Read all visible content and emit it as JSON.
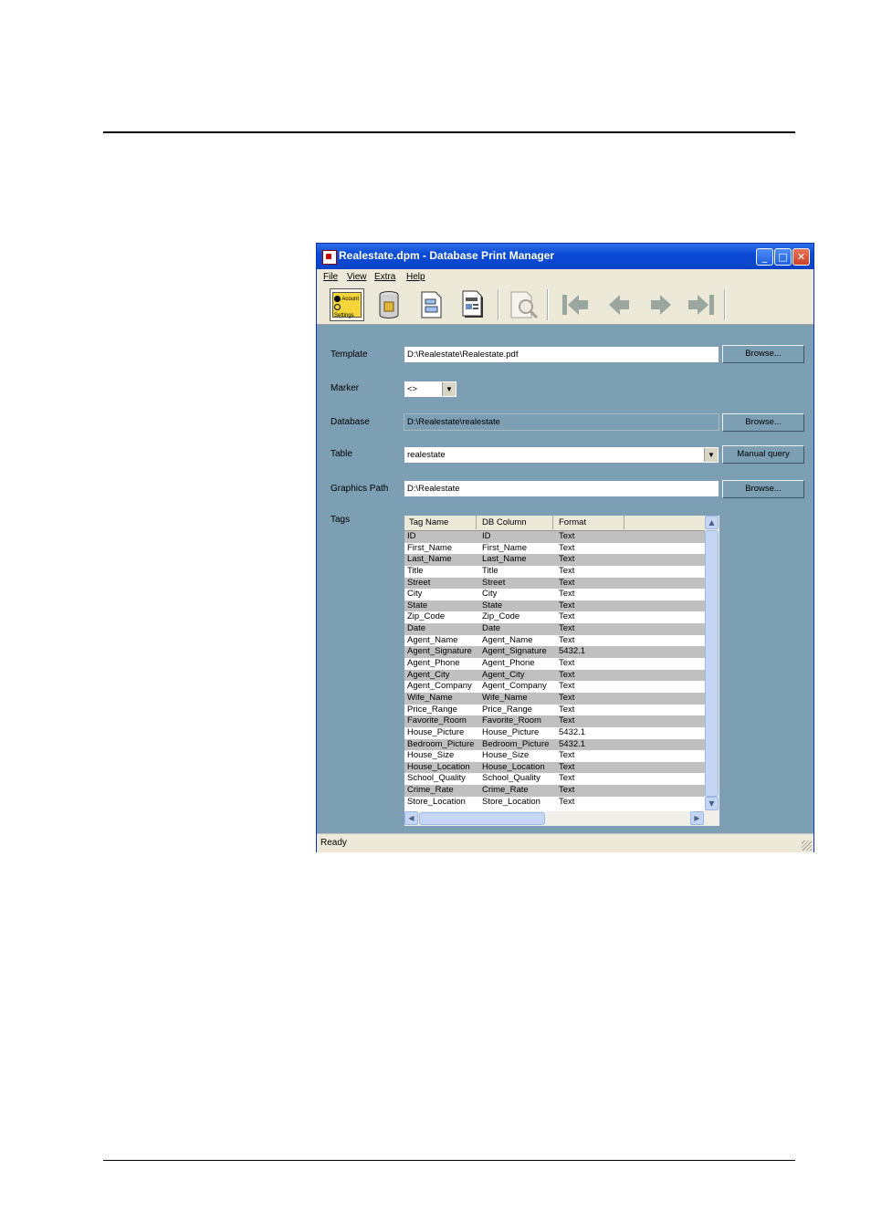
{
  "window": {
    "title": "Realestate.dpm - Database Print Manager",
    "minimize": "_",
    "maximize": "□",
    "close": "✕"
  },
  "menu": [
    "File",
    "View",
    "Extra",
    "Help"
  ],
  "toolbar": {
    "settings_tool": {
      "line1": "Acount",
      "line2": "Settings"
    },
    "icons": [
      "settings-icon",
      "database-icon",
      "template-icon",
      "print-form-icon",
      "print-preview-icon",
      "first-record-icon",
      "previous-record-icon",
      "next-record-icon",
      "last-record-icon"
    ]
  },
  "form": {
    "template": {
      "label": "Template",
      "value": "D:\\Realestate\\Realestate.pdf",
      "button": "Browse..."
    },
    "marker": {
      "label": "Marker",
      "value": "<>"
    },
    "database": {
      "label": "Database",
      "value": "D:\\Realestate\\realestate",
      "button": "Browse..."
    },
    "table": {
      "label": "Table",
      "value": "realestate",
      "button": "Manual query"
    },
    "graphics": {
      "label": "Graphics Path",
      "value": "D:\\Realestate",
      "button": "Browse..."
    },
    "tags_label": "Tags"
  },
  "tags": {
    "columns": [
      "Tag Name",
      "DB Column",
      "Format"
    ],
    "rows": [
      [
        "ID",
        "ID",
        "Text"
      ],
      [
        "First_Name",
        "First_Name",
        "Text"
      ],
      [
        "Last_Name",
        "Last_Name",
        "Text"
      ],
      [
        "Title",
        "Title",
        "Text"
      ],
      [
        "Street",
        "Street",
        "Text"
      ],
      [
        "City",
        "City",
        "Text"
      ],
      [
        "State",
        "State",
        "Text"
      ],
      [
        "Zip_Code",
        "Zip_Code",
        "Text"
      ],
      [
        "Date",
        "Date",
        "Text"
      ],
      [
        "Agent_Name",
        "Agent_Name",
        "Text"
      ],
      [
        "Agent_Signature",
        "Agent_Signature",
        "5432.1"
      ],
      [
        "Agent_Phone",
        "Agent_Phone",
        "Text"
      ],
      [
        "Agent_City",
        "Agent_City",
        "Text"
      ],
      [
        "Agent_Company",
        "Agent_Company",
        "Text"
      ],
      [
        "Wife_Name",
        "Wife_Name",
        "Text"
      ],
      [
        "Price_Range",
        "Price_Range",
        "Text"
      ],
      [
        "Favorite_Room",
        "Favorite_Room",
        "Text"
      ],
      [
        "House_Picture",
        "House_Picture",
        "5432.1"
      ],
      [
        "Bedroom_Picture",
        "Bedroom_Picture",
        "5432.1"
      ],
      [
        "House_Size",
        "House_Size",
        "Text"
      ],
      [
        "House_Location",
        "House_Location",
        "Text"
      ],
      [
        "School_Quality",
        "School_Quality",
        "Text"
      ],
      [
        "Crime_Rate",
        "Crime_Rate",
        "Text"
      ],
      [
        "Store_Location",
        "Store_Location",
        "Text"
      ]
    ]
  },
  "status": "Ready",
  "colors": {
    "window_bg": "#7d9fb3",
    "titlebar": "#0a4bd6",
    "alt_row": "#c0c0c0"
  }
}
